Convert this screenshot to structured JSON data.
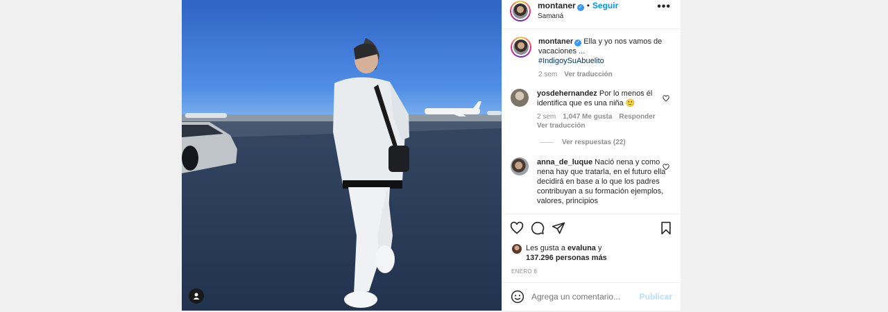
{
  "post": {
    "author": "montaner",
    "follow_label": "Seguir",
    "dot": "•",
    "location": "Samaná",
    "more_label": "•••",
    "verified_mark": "✓"
  },
  "caption": {
    "username": "montaner",
    "text": "Ella y yo nos vamos de vacaciones ...",
    "hashtag": "#IndigoySuAbuelito",
    "time": "2 sem",
    "translate_label": "Ver traducción"
  },
  "comments": [
    {
      "username": "yosdehernandez",
      "text": "Por lo menos él identifica que es una niña 🙂",
      "time": "2 sem",
      "likes": "1,047 Me gusta",
      "reply_label": "Responder",
      "translate_label": "Ver traducción",
      "view_replies": "Ver respuestas (22)"
    },
    {
      "username": "anna_de_luque",
      "text": "Nació nena y como nena hay que tratarla, en el futuro ella decidirá en base a lo que los padres contribuyan a su formación ejemplos, valores, principios"
    }
  ],
  "likes": {
    "prefix": "Les gusta a",
    "user": "evaluna",
    "joiner": "y",
    "others": "137.296 personas más"
  },
  "date": "ENERO 8",
  "add_comment": {
    "placeholder": "Agrega un comentario...",
    "publish_label": "Publicar"
  },
  "icons": {
    "like": "heart-icon",
    "comment": "comment-bubble-icon",
    "share": "paper-plane-icon",
    "save": "bookmark-icon",
    "emoji": "smiley-icon",
    "tag": "user-tag-icon"
  },
  "colors": {
    "accent": "#0095f6",
    "verified": "#3897f0",
    "publish_disabled": "#b2dffc",
    "hashtag": "#00376b",
    "muted": "#8e8e8e"
  }
}
